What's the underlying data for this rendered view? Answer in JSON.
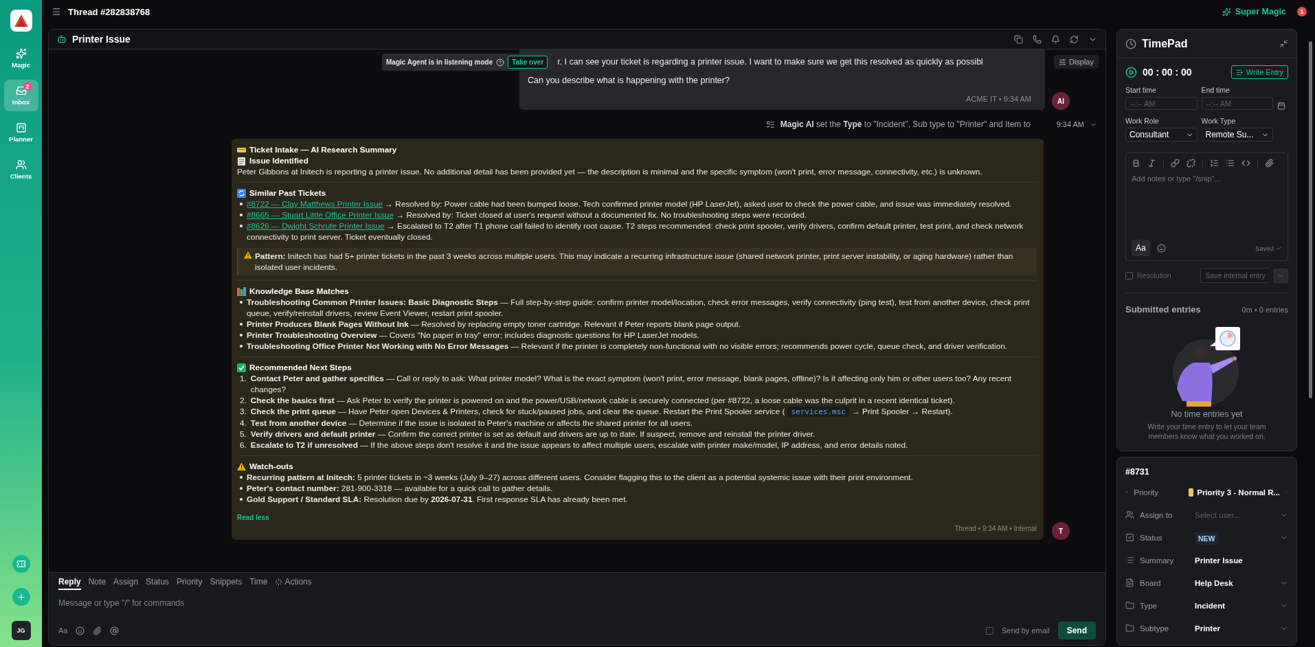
{
  "sidebar": {
    "items": [
      {
        "label": "Magic",
        "selected": false
      },
      {
        "label": "Inbox",
        "selected": true,
        "badge": "2"
      },
      {
        "label": "Planner",
        "selected": false
      },
      {
        "label": "Clients",
        "selected": false
      }
    ],
    "avatar": "JG"
  },
  "topbar": {
    "title": "Thread #282838768",
    "super_magic": "Super Magic",
    "alerts": "1"
  },
  "chat": {
    "title": "Printer Issue",
    "listening": {
      "text": "Magic Agent is in listening mode",
      "action": "Take over"
    },
    "display": "Display",
    "messages": [
      {
        "kind": "reply",
        "lines": [
          "r. I can see your ticket is regarding a printer issue. I want to make sure we get this resolved as quickly as possibl",
          "Can you describe what is happening with the printer?"
        ],
        "meta": "ACME IT • 9:34 AM",
        "avatar": "AI"
      },
      {
        "kind": "event",
        "text": "**Magic AI** set the **Type** to \"Incident\", Sub type to \"Printer\" and Item to",
        "time": "9:34 AM"
      },
      {
        "kind": "note",
        "toggle": "Read less",
        "meta": "Thread • 9:34 AM • Internal",
        "avatar": "T",
        "sections": [
          {
            "kind": "intro",
            "title": "Ticket Intake — AI Research Summary",
            "subtitle": "Issue Identified",
            "text": "Peter Gibbons at Initech is reporting a printer issue. No additional detail has been provided yet — the description is minimal and the specific symptom (won't print, error message, connectivity, etc.) is unknown."
          },
          {
            "kind": "tickets",
            "title": "Similar Past Tickets",
            "items": [
              {
                "link": "#8722 — Clay Matthews Printer Issue",
                "text": "→ Resolved by: Power cable had been bumped loose. Tech confirmed printer model (HP LaserJet), asked user to check the power cable, and issue was immediately resolved."
              },
              {
                "link": "#8665 — Stuart Little Office Printer Issue",
                "text": "→ Resolved by: Ticket closed at user's request without a documented fix. No troubleshooting steps were recorded."
              },
              {
                "link": "#8626 — Dwight Schrute Printer Issue",
                "text": "→ Escalated to T2 after T1 phone call failed to identify root cause. T2 steps recommended: check print spooler, verify drivers, confirm default printer, test print, and check network connectivity to print server. Ticket eventually closed."
              }
            ],
            "callout": "**Pattern:** Initech has had 5+ printer tickets in the past 3 weeks across multiple users. This may indicate a recurring infrastructure issue (shared network printer, print server instability, or aging hardware) rather than isolated user incidents."
          },
          {
            "kind": "bullets",
            "title": "Knowledge Base Matches",
            "items": [
              {
                "text": "**Troubleshooting Common Printer Issues: Basic Diagnostic Steps** — Full step-by-step guide: confirm printer model/location, check error messages, verify connectivity (ping test), test from another device, check print queue, verify/reinstall drivers, review Event Viewer, restart print spooler."
              },
              {
                "text": "**Printer Produces Blank Pages Without Ink** — Resolved by replacing empty toner cartridge. Relevant if Peter reports blank page output."
              },
              {
                "text": "**Printer Troubleshooting Overview** — Covers \"No paper in tray\" error; includes diagnostic questions for HP LaserJet models."
              },
              {
                "text": "**Troubleshooting Office Printer Not Working with No Error Messages** — Relevant if the printer is completely non-functional with no visible errors; recommends power cycle, queue check, and driver verification."
              }
            ]
          },
          {
            "kind": "steps",
            "title": "Recommended Next Steps",
            "items": [
              {
                "number": "1.",
                "text": "**Contact Peter and gather specifics** — Call or reply to ask: What printer model? What is the exact symptom (won't print, error message, blank pages, offline)? Is it affecting only him or other users too? Any recent changes?"
              },
              {
                "number": "2.",
                "text": "**Check the basics first** — Ask Peter to verify the printer is powered on and the power/USB/network cable is securely connected (per #8722, a loose cable was the culprit in a recent identical ticket)."
              },
              {
                "number": "3.",
                "text": "**Check the print queue** — Have Peter open Devices & Printers, check for stuck/paused jobs, and clear the queue. Restart the Print Spooler service (",
                "code": "services.msc",
                "after": "→ Print Spooler → Restart)."
              },
              {
                "number": "4.",
                "text": "**Test from another device** — Determine if the issue is isolated to Peter's machine or affects the shared printer for all users."
              },
              {
                "number": "5.",
                "text": "**Verify drivers and default printer** — Confirm the correct printer is set as default and drivers are up to date. If suspect, remove and reinstall the printer driver."
              },
              {
                "number": "6.",
                "text": "**Escalate to T2 if unresolved** — If the above steps don't resolve it and the issue appears to affect multiple users, escalate with printer make/model, IP address, and error details noted."
              }
            ]
          },
          {
            "kind": "bullets",
            "title": "Watch-outs",
            "items": [
              {
                "text": "**Recurring pattern at Initech:** 5 printer tickets in ~3 weeks (July 9–27) across different users. Consider flagging this to the client as a potential systemic issue with their print environment."
              },
              {
                "text": "**Peter's contact number:** 281-900-3318 — available for a quick call to gather details."
              },
              {
                "text": "**Gold Support / Standard SLA:** Resolution due by **2026-07-31**. First response SLA has already been met."
              }
            ]
          }
        ]
      }
    ]
  },
  "compose": {
    "tabs": [
      {
        "label": "Reply",
        "selected": true
      },
      {
        "label": "Note",
        "selected": false
      },
      {
        "label": "Assign",
        "selected": false
      },
      {
        "label": "Status",
        "selected": false
      },
      {
        "label": "Priority",
        "selected": false
      },
      {
        "label": "Snippets",
        "selected": false
      },
      {
        "label": "Time",
        "selected": false
      },
      {
        "label": "Actions",
        "selected": false,
        "icon": true
      }
    ],
    "placeholder": "Message or type \"/\" for commands",
    "format": "Aa",
    "send_by_email": {
      "label": "Send by email",
      "checked": false
    },
    "send": "Send"
  },
  "timepad": {
    "title": "TimePad",
    "timer": "00 : 00 : 00",
    "write_entry": "Write Entry",
    "start_time": {
      "label": "Start time",
      "placeholder": "--:-- AM"
    },
    "end_time": {
      "label": "End time",
      "placeholder": "--:-- AM"
    },
    "work_role": {
      "label": "Work Role",
      "value": "Consultant"
    },
    "work_type": {
      "label": "Work Type",
      "value": "Remote Su..."
    },
    "notes": {
      "placeholder": "Add notes or type \"/snip\"...",
      "format": "Aa",
      "saved": "Saved"
    },
    "resolution": {
      "label": "Resolution",
      "checked": false
    },
    "save": "Save internal entry",
    "submitted": {
      "title": "Submitted entries",
      "summary": "0m • 0 entries",
      "empty_title": "No time entries yet",
      "empty_text": "Write your time entry to let your team members know what you worked on."
    }
  },
  "ticket": {
    "number": "#8731",
    "fields": [
      {
        "label": "Priority",
        "kind": "priority",
        "value": "Priority 3 - Normal R...",
        "color": "#f6c46a"
      },
      {
        "label": "Assign to",
        "kind": "placeholder",
        "placeholder": "Select user..."
      },
      {
        "label": "Status",
        "kind": "badge",
        "value": "NEW"
      },
      {
        "label": "Summary",
        "kind": "text",
        "value": "Printer Issue"
      },
      {
        "label": "Board",
        "kind": "select",
        "value": "Help Desk"
      },
      {
        "label": "Type",
        "kind": "select",
        "value": "Incident"
      },
      {
        "label": "Subtype",
        "kind": "select",
        "value": "Printer"
      }
    ]
  }
}
